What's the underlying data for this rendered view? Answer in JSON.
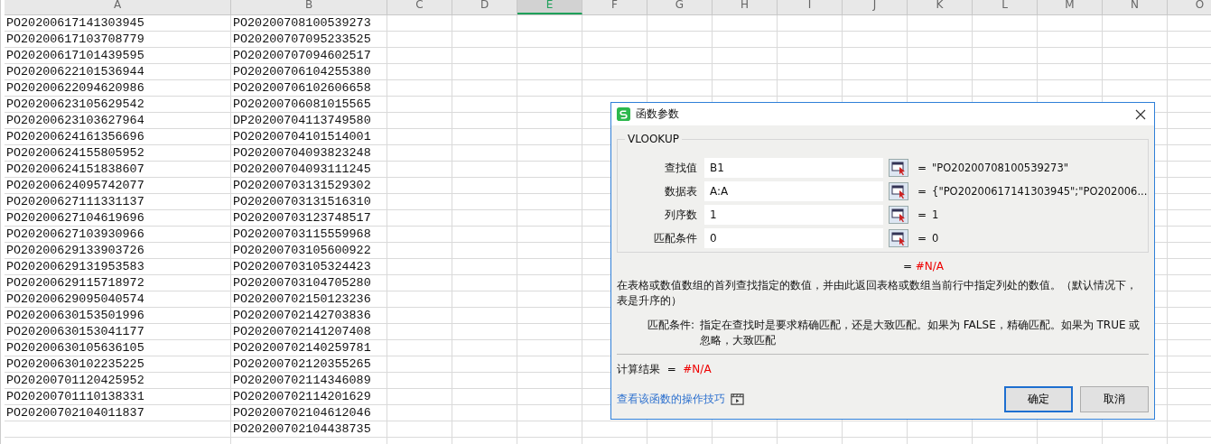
{
  "sheet": {
    "columns": [
      {
        "label": "A",
        "selected": false
      },
      {
        "label": "B",
        "selected": false
      },
      {
        "label": "C",
        "selected": false
      },
      {
        "label": "D",
        "selected": false
      },
      {
        "label": "E",
        "selected": true
      },
      {
        "label": "F",
        "selected": false
      },
      {
        "label": "G",
        "selected": false
      },
      {
        "label": "H",
        "selected": false
      },
      {
        "label": "I",
        "selected": false
      },
      {
        "label": "J",
        "selected": false
      },
      {
        "label": "K",
        "selected": false
      },
      {
        "label": "L",
        "selected": false
      },
      {
        "label": "M",
        "selected": false
      },
      {
        "label": "N",
        "selected": false
      },
      {
        "label": "O",
        "selected": false
      }
    ],
    "rows": [
      [
        "PO20200617141303945",
        "PO20200708100539273"
      ],
      [
        "PO20200617103708779",
        "PO20200707095233525"
      ],
      [
        "PO20200617101439595",
        "PO20200707094602517"
      ],
      [
        "PO20200622101536944",
        "PO20200706104255380"
      ],
      [
        "PO20200622094620986",
        "PO20200706102606658"
      ],
      [
        "PO20200623105629542",
        "PO20200706081015565"
      ],
      [
        "PO20200623103627964",
        "DP20200704113749580"
      ],
      [
        "PO20200624161356696",
        "PO20200704101514001"
      ],
      [
        "PO20200624155805952",
        "PO20200704093823248"
      ],
      [
        "PO20200624151838607",
        "PO20200704093111245"
      ],
      [
        "PO20200624095742077",
        "PO20200703131529302"
      ],
      [
        "PO20200627111331137",
        "PO20200703131516310"
      ],
      [
        "PO20200627104619696",
        "PO20200703123748517"
      ],
      [
        "PO20200627103930966",
        "PO20200703115559968"
      ],
      [
        "PO20200629133903726",
        "PO20200703105600922"
      ],
      [
        "PO20200629131953583",
        "PO20200703105324423"
      ],
      [
        "PO20200629115718972",
        "PO20200703104705280"
      ],
      [
        "PO20200629095040574",
        "PO20200702150123236"
      ],
      [
        "PO20200630153501996",
        "PO20200702142703836"
      ],
      [
        "PO20200630153041177",
        "PO20200702141207408"
      ],
      [
        "PO20200630105636105",
        "PO20200702140259781"
      ],
      [
        "PO20200630102235225",
        "PO20200702120355265"
      ],
      [
        "PO20200701120425952",
        "PO20200702114346089"
      ],
      [
        "PO20200701110138331",
        "PO20200702114201629"
      ],
      [
        "PO20200702104011837",
        "PO20200702104612046"
      ],
      [
        "",
        "PO20200702104438735"
      ]
    ]
  },
  "dialog": {
    "title": "函数参数",
    "function": "VLOOKUP",
    "args": [
      {
        "label": "查找值",
        "value": "B1",
        "eq": "=",
        "result": "\"PO20200708100539273\""
      },
      {
        "label": "数据表",
        "value": "A:A",
        "eq": "=",
        "result": "{\"PO20200617141303945\";\"PO202006..."
      },
      {
        "label": "列序数",
        "value": "1",
        "eq": "=",
        "result": "1"
      },
      {
        "label": "匹配条件",
        "value": "0",
        "eq": "=",
        "result": "0"
      }
    ],
    "formula_eq": "=",
    "formula_result": "#N/A",
    "description": "在表格或数值数组的首列查找指定的数值，并由此返回表格或数组当前行中指定列处的数值。（默认情况下，表是升序的）",
    "arg_help_label": "匹配条件:",
    "arg_help": "指定在查找时是要求精确匹配，还是大致匹配。如果为 FALSE，精确匹配。如果为 TRUE 或忽略，大致匹配",
    "calc_label": "计算结果",
    "calc_eq": "=",
    "calc_result": "#N/A",
    "help_link": "查看该函数的操作技巧",
    "buttons": [
      {
        "label": "确定",
        "kind": "primary"
      },
      {
        "label": "取消",
        "kind": "normal"
      }
    ]
  }
}
